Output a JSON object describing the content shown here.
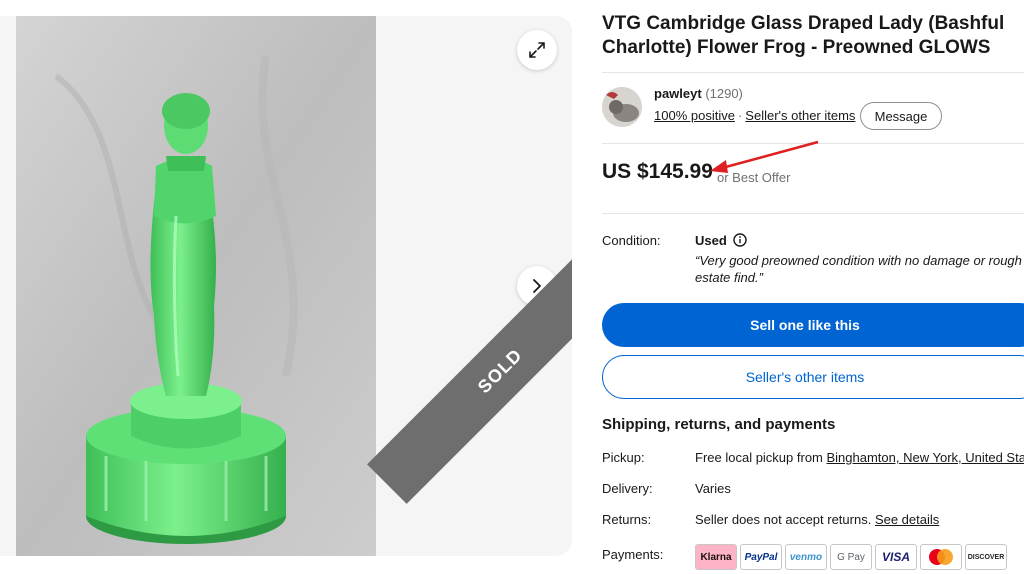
{
  "listing": {
    "title": "VTG Cambridge Glass Draped Lady (Bashful Charlotte) Flower Frog - Preowned GLOWS",
    "sold_badge": "SOLD"
  },
  "seller": {
    "name": "pawleyt",
    "feedback_count": "(1290)",
    "positive": "100% positive",
    "other_items_link": "Seller's other items",
    "message_label": "Message"
  },
  "price": {
    "amount": "US $145.99",
    "best_offer": "or Best Offer"
  },
  "condition": {
    "label": "Condition:",
    "value": "Used",
    "description": "“Very good preowned condition with no damage or rough estate find.”"
  },
  "buttons": {
    "sell_one": "Sell one like this",
    "sellers_other_items": "Seller's other items"
  },
  "shipping": {
    "title": "Shipping, returns, and payments",
    "pickup_label": "Pickup:",
    "pickup_text": "Free local pickup from ",
    "pickup_location": "Binghamton, New York, United State",
    "delivery_label": "Delivery:",
    "delivery_value": "Varies",
    "returns_label": "Returns:",
    "returns_value": "Seller does not accept returns. ",
    "returns_link": "See details",
    "payments_label": "Payments:",
    "payment_methods": [
      "Klarna",
      "PayPal",
      "venmo",
      "G Pay",
      "VISA",
      "mastercard",
      "DISCOVER"
    ]
  },
  "colors": {
    "primary": "#0064d2",
    "text": "#191919",
    "muted": "#707070",
    "glass_green": "#4fd46a",
    "annotation_arrow": "#e02020"
  }
}
